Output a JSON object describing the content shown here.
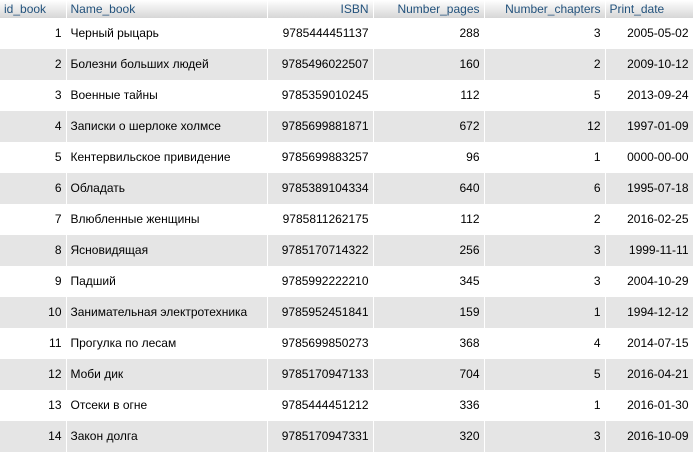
{
  "table": {
    "columns": [
      {
        "key": "id_book",
        "label": "id_book",
        "align": "left"
      },
      {
        "key": "name",
        "label": "Name_book",
        "align": "left"
      },
      {
        "key": "isbn",
        "label": "ISBN",
        "align": "right"
      },
      {
        "key": "pages",
        "label": "Number_pages",
        "align": "right"
      },
      {
        "key": "chapters",
        "label": "Number_chapters",
        "align": "right"
      },
      {
        "key": "date",
        "label": "Print_date",
        "align": "left"
      }
    ],
    "rows": [
      {
        "id_book": "1",
        "name": "Черный рыцарь",
        "isbn": "9785444451137",
        "pages": "288",
        "chapters": "3",
        "date": "2005-05-02"
      },
      {
        "id_book": "2",
        "name": "Болезни больших людей",
        "isbn": "9785496022507",
        "pages": "160",
        "chapters": "2",
        "date": "2009-10-12"
      },
      {
        "id_book": "3",
        "name": "Военные тайны",
        "isbn": "9785359010245",
        "pages": "112",
        "chapters": "5",
        "date": "2013-09-24"
      },
      {
        "id_book": "4",
        "name": "Записки о шерлоке холмсе",
        "isbn": "9785699881871",
        "pages": "672",
        "chapters": "12",
        "date": "1997-01-09"
      },
      {
        "id_book": "5",
        "name": "Кентервильское привидение",
        "isbn": "9785699883257",
        "pages": "96",
        "chapters": "1",
        "date": "0000-00-00"
      },
      {
        "id_book": "6",
        "name": "Обладать",
        "isbn": "9785389104334",
        "pages": "640",
        "chapters": "6",
        "date": "1995-07-18"
      },
      {
        "id_book": "7",
        "name": "Влюбленные женщины",
        "isbn": "9785811262175",
        "pages": "112",
        "chapters": "2",
        "date": "2016-02-25"
      },
      {
        "id_book": "8",
        "name": "Ясновидящая",
        "isbn": "9785170714322",
        "pages": "256",
        "chapters": "3",
        "date": "1999-11-11"
      },
      {
        "id_book": "9",
        "name": "Падший",
        "isbn": "9785992222210",
        "pages": "345",
        "chapters": "3",
        "date": "2004-10-29"
      },
      {
        "id_book": "10",
        "name": "Занимательная электротехника",
        "isbn": "9785952451841",
        "pages": "159",
        "chapters": "1",
        "date": "1994-12-12"
      },
      {
        "id_book": "11",
        "name": "Прогулка по лесам",
        "isbn": "9785699850273",
        "pages": "368",
        "chapters": "4",
        "date": "2014-07-15"
      },
      {
        "id_book": "12",
        "name": "Моби дик",
        "isbn": "9785170947133",
        "pages": "704",
        "chapters": "5",
        "date": "2016-04-21"
      },
      {
        "id_book": "13",
        "name": "Отсеки в огне",
        "isbn": "9785444451212",
        "pages": "336",
        "chapters": "1",
        "date": "2016-01-30"
      },
      {
        "id_book": "14",
        "name": "Закон долга",
        "isbn": "9785170947331",
        "pages": "320",
        "chapters": "3",
        "date": "2016-10-09"
      }
    ]
  },
  "colors": {
    "header_text": "#23527c",
    "row_alt_bg": "#e5e5e5",
    "row_bg": "#ffffff"
  }
}
